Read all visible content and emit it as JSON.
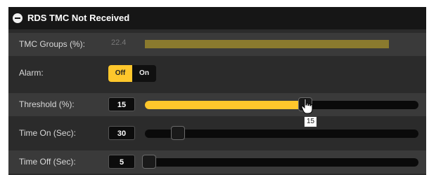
{
  "header": {
    "title": "RDS TMC Not Received"
  },
  "tmc_groups": {
    "label": "TMC Groups (%):",
    "value": "22.4",
    "meter_fraction": 0.9
  },
  "alarm": {
    "label": "Alarm:",
    "off_label": "Off",
    "on_label": "On",
    "selected": "Off"
  },
  "threshold": {
    "label": "Threshold (%):",
    "value": "15",
    "slider_fraction": 0.59,
    "tooltip": "15"
  },
  "time_on": {
    "label": "Time On (Sec):",
    "value": "30",
    "slider_fraction": 0.1
  },
  "time_off": {
    "label": "Time Off (Sec):",
    "value": "5",
    "slider_fraction": 0.0
  },
  "colors": {
    "accent": "#ffc72c",
    "meter": "#8a7a2e",
    "panel": "#2b2b2b",
    "header": "#161616"
  }
}
